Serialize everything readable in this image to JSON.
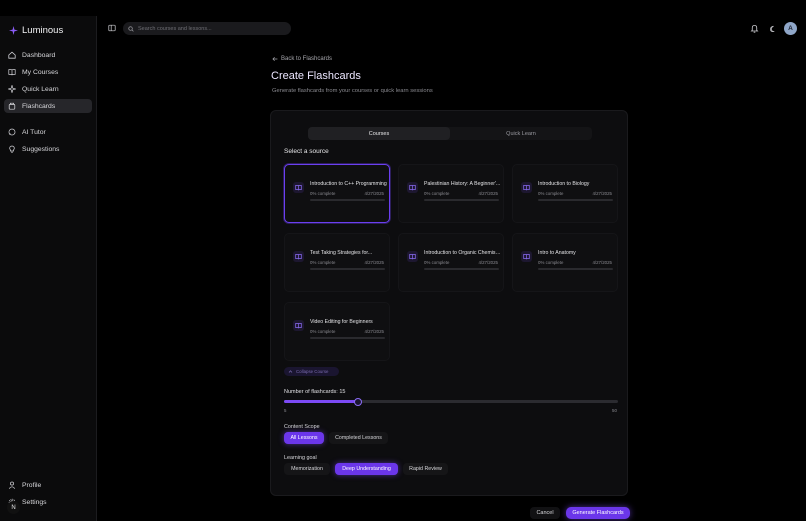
{
  "app": {
    "name": "Luminous",
    "brand_color": "#7c4af5"
  },
  "sidebar": {
    "items": [
      {
        "label": "Dashboard",
        "icon": "home-icon"
      },
      {
        "label": "My Courses",
        "icon": "book-icon"
      },
      {
        "label": "Quick Learn",
        "icon": "zap-icon"
      },
      {
        "label": "Flashcards",
        "icon": "flashcards-icon",
        "active": true
      },
      {
        "label": "AI Tutor",
        "icon": "chat-icon"
      },
      {
        "label": "Suggestions",
        "icon": "lightbulb-icon"
      }
    ],
    "bottom": [
      {
        "label": "Profile",
        "icon": "user-icon"
      },
      {
        "label": "Settings",
        "icon": "gear-icon"
      }
    ],
    "badge_letter": "N"
  },
  "header": {
    "search_placeholder": "Search courses and lessons...",
    "avatar_letter": "A"
  },
  "main": {
    "back_label": "Back to Flashcards",
    "title": "Create Flashcards",
    "subtitle": "Generate flashcards from your courses or quick learn sessions",
    "tabs": [
      {
        "label": "Courses",
        "active": true
      },
      {
        "label": "Quick Learn",
        "active": false
      }
    ],
    "select_label": "Select a source",
    "cards": [
      {
        "title": "Introduction to C++ Programming",
        "progress": "0% complete",
        "date": "4/27/2025",
        "selected": true
      },
      {
        "title": "Palestinian History: A Beginner'...",
        "progress": "0% complete",
        "date": "4/27/2025"
      },
      {
        "title": "Introduction to Biology",
        "progress": "0% complete",
        "date": "4/27/2025"
      },
      {
        "title": "Test Taking Strategies for...",
        "progress": "0% complete",
        "date": "4/27/2025"
      },
      {
        "title": "Introduction to Organic Chemistry",
        "progress": "0% complete",
        "date": "4/27/2025"
      },
      {
        "title": "Intro to Anatomy",
        "progress": "0% complete",
        "date": "4/27/2025"
      },
      {
        "title": "Video Editing for Beginners",
        "progress": "0% complete",
        "date": "4/27/2025"
      }
    ],
    "collapse_label": "Collapse Course",
    "flashcards_label": "Number of flashcards: 15",
    "slider": {
      "min_label": "5",
      "max_label": "50",
      "value": 15,
      "min": 5,
      "max": 50
    },
    "content_scope": {
      "label": "Content Scope",
      "options": [
        {
          "label": "All Lessons",
          "active": true
        },
        {
          "label": "Completed Lessons",
          "active": false
        }
      ]
    },
    "learning_goal": {
      "label": "Learning goal",
      "options": [
        {
          "label": "Memorization",
          "active": false
        },
        {
          "label": "Deep Understanding",
          "active": true
        },
        {
          "label": "Rapid Review",
          "active": false
        }
      ]
    },
    "cancel_label": "Cancel",
    "generate_label": "Generate Flashcards"
  }
}
